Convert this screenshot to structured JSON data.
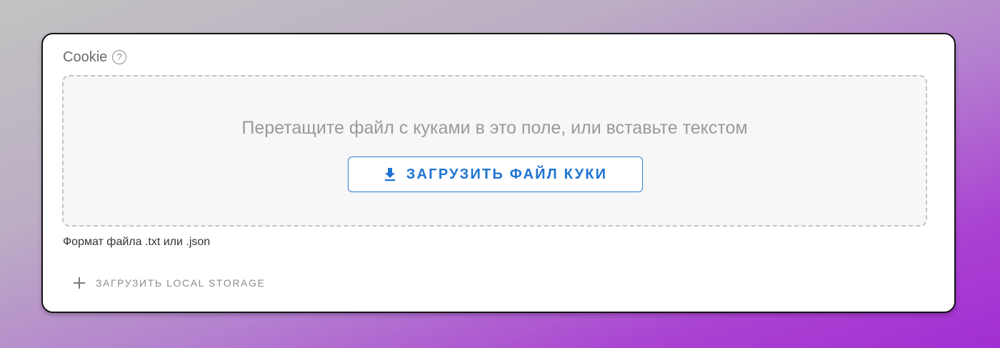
{
  "cookie_field": {
    "label": "Cookie",
    "help_icon": "help-circle-icon",
    "help_glyph": "?",
    "dropzone": {
      "hint": "Перетащите файл с куками в это поле, или вставьте текстом",
      "upload_button": {
        "icon": "download-icon",
        "label": "ЗАГРУЗИТЬ ФАЙЛ КУКИ"
      }
    },
    "format_note": "Формат файла .txt или .json"
  },
  "local_storage": {
    "icon": "plus-icon",
    "label": "ЗАГРУЗИТЬ LOCAL STORAGE"
  },
  "colors": {
    "accent": "#1f74d1",
    "card_border": "#141414",
    "dropzone_bg": "#f7f7f7",
    "dropzone_border": "#c4c4c4",
    "muted_text": "#9a9a9a"
  }
}
